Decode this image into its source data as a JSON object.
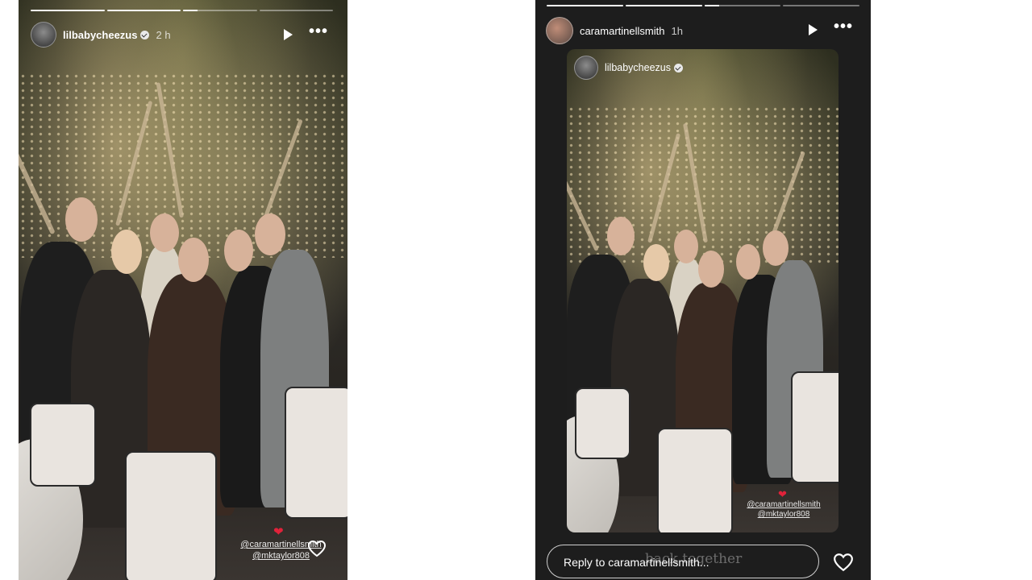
{
  "left_story": {
    "username": "lilbabycheezus",
    "time": "2 h",
    "progress": [
      1,
      1,
      0.2,
      0
    ],
    "tags": [
      "@caramartinellsmith",
      "@mktaylor808"
    ]
  },
  "right_story": {
    "username": "caramartinellsmith",
    "time": "1h",
    "progress": [
      1,
      1,
      0.2,
      0
    ],
    "shared_post": {
      "username": "lilbabycheezus",
      "tags": [
        "@caramartinellsmith",
        "@mktaylor808"
      ]
    },
    "reply_placeholder": "Reply to caramartinellsmith...",
    "caption": "back together"
  },
  "icons": {
    "play": "play-icon",
    "more": "more-options-icon",
    "like": "heart-outline-icon",
    "verified": "verified-badge-icon",
    "heart_emoji": "red-heart-emoji"
  },
  "colors": {
    "dark_bg": "#1d1d1d",
    "heart_red": "#e0223a"
  }
}
